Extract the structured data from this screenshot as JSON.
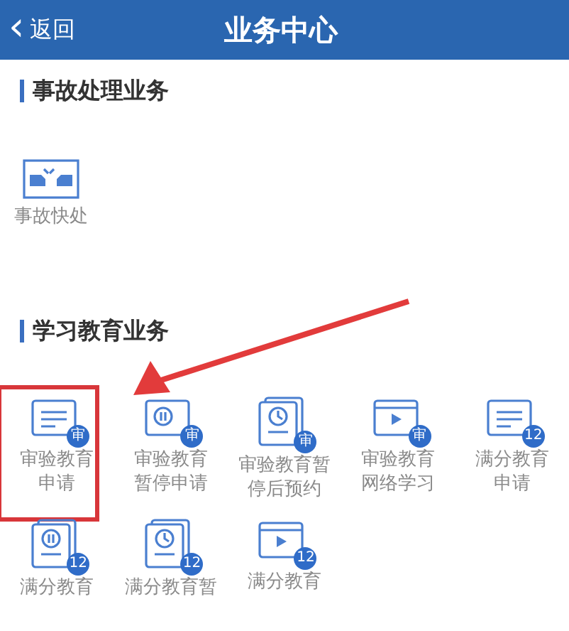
{
  "header": {
    "back_icon": "‹",
    "back_label": "返回",
    "title": "业务中心"
  },
  "sections": [
    {
      "title": "事故处理业务",
      "items": [
        {
          "kind": "crash",
          "label_lines": [
            "事故快处"
          ],
          "highlighted": false
        }
      ]
    },
    {
      "title": "学习教育业务",
      "items": [
        {
          "kind": "doc",
          "badge": "审",
          "label_lines": [
            "审验教育",
            "申请"
          ],
          "highlighted": true
        },
        {
          "kind": "pause",
          "badge": "审",
          "label_lines": [
            "审验教育",
            "暂停申请"
          ],
          "highlighted": false
        },
        {
          "kind": "clock",
          "badge": "审",
          "label_lines": [
            "审验教育暂",
            "停后预约"
          ],
          "highlighted": false
        },
        {
          "kind": "video",
          "badge": "审",
          "label_lines": [
            "审验教育",
            "网络学习"
          ],
          "highlighted": false
        },
        {
          "kind": "doc",
          "badge": "12",
          "label_lines": [
            "满分教育",
            "申请"
          ],
          "highlighted": false
        },
        {
          "kind": "stack",
          "badge": "12",
          "label_lines": [
            "满分教育"
          ],
          "highlighted": false
        },
        {
          "kind": "clock",
          "badge": "12",
          "label_lines": [
            "满分教育暂"
          ],
          "highlighted": false
        },
        {
          "kind": "video",
          "badge": "12",
          "label_lines": [
            "满分教育"
          ],
          "highlighted": false
        }
      ]
    }
  ]
}
